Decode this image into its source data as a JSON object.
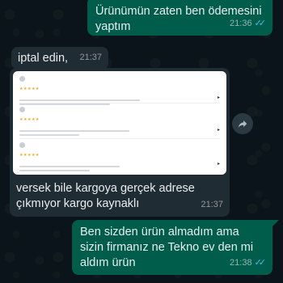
{
  "messages": [
    {
      "direction": "outgoing",
      "text": "Ürünümün  zaten ben ödemesini yaptım",
      "time": "21:36",
      "status": "read"
    },
    {
      "direction": "incoming",
      "text": "iptal edin,",
      "time": "21:37"
    },
    {
      "direction": "incoming",
      "type": "image",
      "caption": "versek bile kargoya gerçek adrese çıkmıyor kargo kaynaklı",
      "time": "21:37",
      "image_reviews": [
        {
          "stars": "★★★★★"
        },
        {
          "stars": "★★★★★"
        },
        {
          "stars": "★★★★★"
        }
      ]
    },
    {
      "direction": "outgoing",
      "text": "Ben sizden ürün almadım  ama sizin firmanız ne Tekno ev den mi aldım ürün",
      "time": "21:38",
      "status": "read"
    }
  ],
  "icons": {
    "read_receipt": "double-check-icon",
    "forward": "forward-share-icon"
  },
  "colors": {
    "background": "#0b141a",
    "outgoing_bubble": "#005c4b",
    "incoming_bubble": "#202c33",
    "read_ticks": "#53bdeb"
  }
}
